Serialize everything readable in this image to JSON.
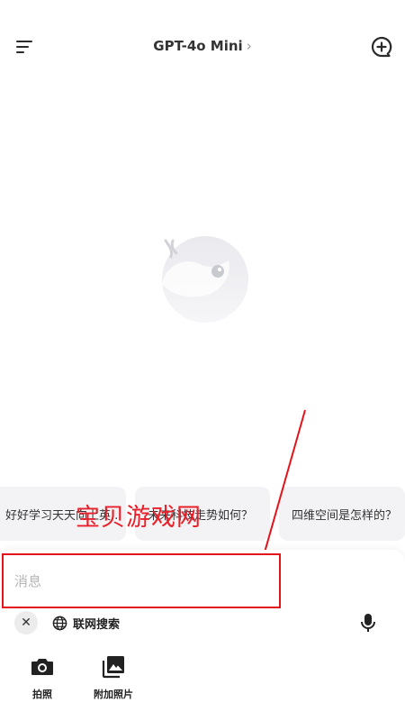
{
  "header": {
    "menu_icon": "menu-icon",
    "model_name": "GPT-4o Mini",
    "chevron": "›",
    "new_chat_icon": "new-chat-icon"
  },
  "mascot_icon": "whale-mascot-icon",
  "suggestions": [
    "好好学习天天向上英...",
    "未来科技走势如何？",
    "四维空间是怎样的？"
  ],
  "watermark": "宝贝游戏网",
  "composer": {
    "placeholder": "消息",
    "value": "",
    "close_label": "✕",
    "search_label": "联网搜索",
    "search_icon": "globe-icon",
    "mic_icon": "microphone-icon"
  },
  "attachments": [
    {
      "label": "拍照",
      "icon": "camera-icon"
    },
    {
      "label": "附加照片",
      "icon": "photo-library-icon"
    }
  ],
  "colors": {
    "accent_red": "#e3141b",
    "chip_bg": "#f3f3f5",
    "text": "#222222"
  }
}
